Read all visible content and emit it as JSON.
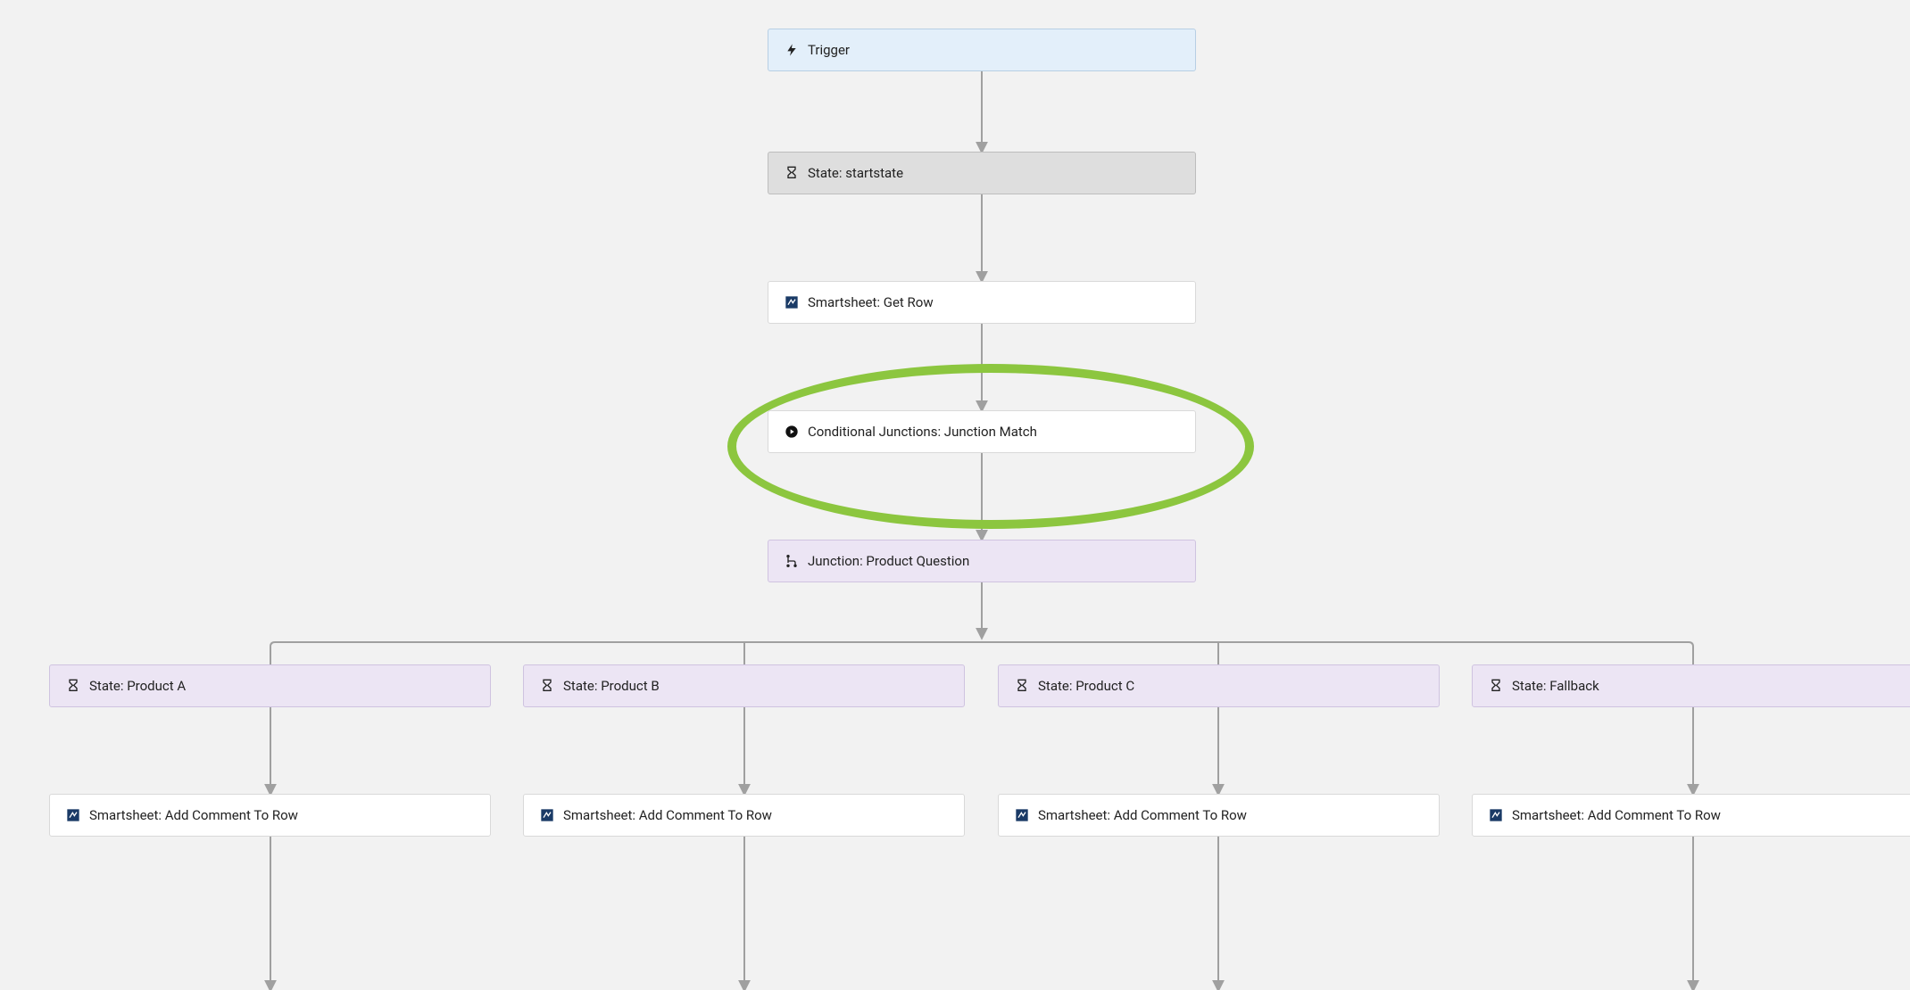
{
  "nodes": {
    "trigger": {
      "label": "Trigger"
    },
    "startstate": {
      "label": "State: startstate"
    },
    "getrow": {
      "label": "Smartsheet: Get Row"
    },
    "junctionmatch": {
      "label": "Conditional Junctions: Junction Match"
    },
    "junction": {
      "label": "Junction: Product Question"
    },
    "stateA": {
      "label": "State: Product A"
    },
    "stateB": {
      "label": "State: Product B"
    },
    "stateC": {
      "label": "State: Product C"
    },
    "stateFallback": {
      "label": "State: Fallback"
    },
    "commentA": {
      "label": "Smartsheet: Add Comment To Row"
    },
    "commentB": {
      "label": "Smartsheet: Add Comment To Row"
    },
    "commentC": {
      "label": "Smartsheet: Add Comment To Row"
    },
    "commentFallback": {
      "label": "Smartsheet: Add Comment To Row"
    }
  },
  "colors": {
    "highlight": "#8cc63f",
    "connector": "#a0a0a0"
  }
}
